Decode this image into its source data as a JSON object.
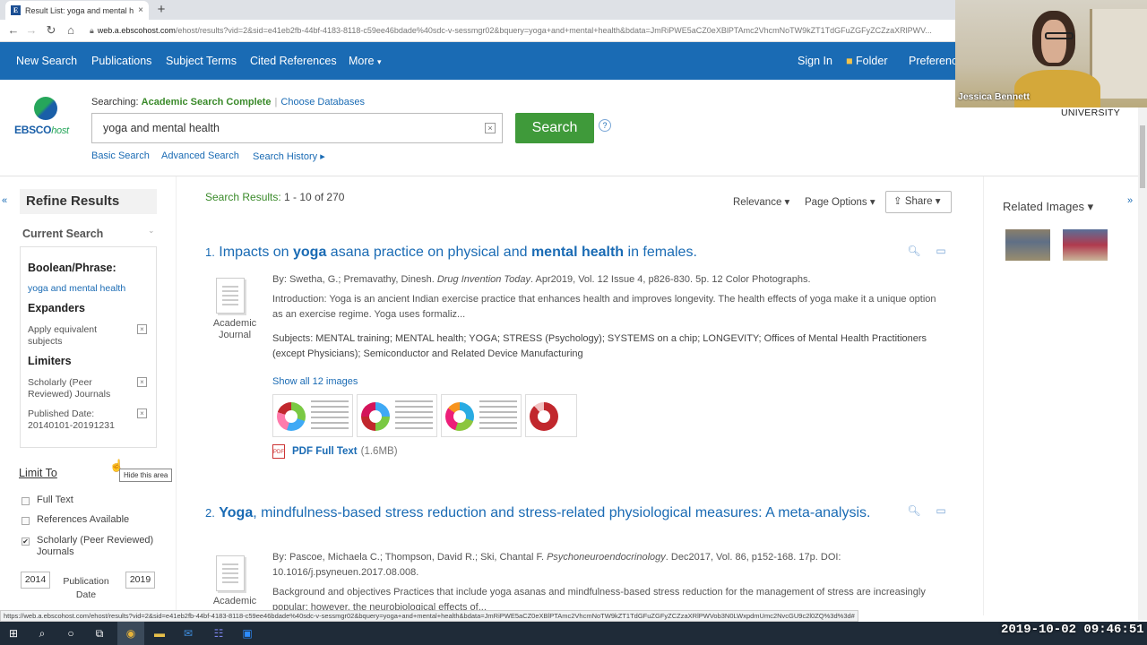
{
  "browser": {
    "tab_title": "Result List: yoga and mental hea",
    "tab_close": "×",
    "new_tab": "+",
    "url_domain": "web.a.ebscohost.com",
    "url_rest": "/ehost/results?vid=2&sid=e41eb2fb-44bf-4183-8118-c59ee46bdade%40sdc-v-sessmgr02&bquery=yoga+and+mental+health&bdata=JmRiPWE5aCZ0eXBlPTAmc2VhcmNoTW9kZT1TdGFuZGFyZCZzaXRlPWV..."
  },
  "nav": {
    "items": [
      "New Search",
      "Publications",
      "Subject Terms",
      "Cited References",
      "More"
    ],
    "more_caret": "▾",
    "sign_in": "Sign In",
    "folder": "Folder",
    "preferences": "Preferenc"
  },
  "header": {
    "logo_main": "EBSCO",
    "logo_sub": "host",
    "searching_label": "Searching:",
    "database": "Academic Search Complete",
    "choose_db": "Choose Databases",
    "query": "yoga and mental health",
    "clear": "×",
    "search_button": "Search",
    "help": "?",
    "basic_search": "Basic Search",
    "advanced_search": "Advanced Search",
    "search_history": "Search History ▸",
    "university": "UNIVERSITY"
  },
  "refine": {
    "collapse": "«",
    "title": "Refine Results",
    "current_search": "Current Search",
    "current_caret": "⌄",
    "boolean_label": "Boolean/Phrase:",
    "boolean_value": "yoga and mental health",
    "expanders_label": "Expanders",
    "expander_1": "Apply equivalent subjects",
    "limiters_label": "Limiters",
    "limiter_1": "Scholarly (Peer Reviewed) Journals",
    "limiter_2": "Published Date: 20140101-20191231",
    "remove": "×",
    "limit_to": "Limit To",
    "hide_tip": "Hide this area",
    "cb_full_text": "Full Text",
    "cb_references": "References Available",
    "cb_scholarly": "Scholarly (Peer Reviewed) Journals",
    "cb_scholarly_checked": "✔",
    "year_from": "2014",
    "year_to": "2019",
    "pub_date": "Publication Date"
  },
  "results": {
    "count_label": "Search Results:",
    "count_value": "1 - 10 of 270",
    "relevance": "Relevance ▾",
    "page_options": "Page Options ▾",
    "share": "Share ▾",
    "items": [
      {
        "num": "1.",
        "title_parts": [
          "Impacts on ",
          "yoga",
          " asana practice on physical and ",
          "mental health",
          " in females."
        ],
        "pub_type": "Academic Journal",
        "byline_pre": "By: Swetha, G.; Premavathy, Dinesh. ",
        "byline_source": "Drug Invention Today",
        "byline_post": ". Apr2019, Vol. 12 Issue 4, p826-830. 5p. 12 Color Photographs.",
        "abstract": "Introduction: Yoga is an ancient Indian exercise practice that enhances health and improves longevity. The health effects of yoga make it a unique option as an exercise regime. Yoga uses formaliz...",
        "subjects": "Subjects: MENTAL training; MENTAL health; YOGA; STRESS (Psychology); SYSTEMS on a chip; LONGEVITY; Offices of Mental Health Practitioners (except Physicians); Semiconductor and Related Device Manufacturing",
        "show_images": "Show all 12 images",
        "pdf_label": "PDF Full Text",
        "pdf_size": "(1.6MB)"
      },
      {
        "num": "2.",
        "title_parts": [
          "Yoga",
          ", mindfulness-based stress reduction and stress-related physiological measures: A meta-analysis."
        ],
        "pub_type": "Academic Journal",
        "byline_pre": "By: Pascoe, Michaela C.; Thompson, David R.; Ski, Chantal F. ",
        "byline_source": "Psychoneuroendocrinology",
        "byline_post": ". Dec2017, Vol. 86, p152-168. 17p. DOI: 10.1016/j.psyneuen.2017.08.008.",
        "abstract": "Background and objectives Practices that include yoga asanas and mindfulness-based stress reduction for the management of stress are increasingly popular; however, the neurobiological effects of..."
      }
    ]
  },
  "related": {
    "title": "Related Images ▾",
    "collapse": "»"
  },
  "webcam": {
    "name": "Jessica Bennett"
  },
  "status_url": "https://web.a.ebscohost.com/ehost/results?vid=2&sid=e41eb2fb-44bf-4183-8118-c59ee46bdade%40sdc-v-sessmgr02&bquery=yoga+and+mental+health&bdata=JmRiPWE5aCZ0eXBlPTAmc2VhcmNoTW9kZT1TdGFuZGFyZCZzaXRlPWVob3N0LWxpdmUmc2NvcGU9c2l0ZQ%3d%3d#",
  "clock": "2019-10-02 09:46:51",
  "colors": {
    "nav_blue": "#1a6bb4",
    "search_green": "#3f9a3a",
    "db_green": "#3a8a2a"
  }
}
